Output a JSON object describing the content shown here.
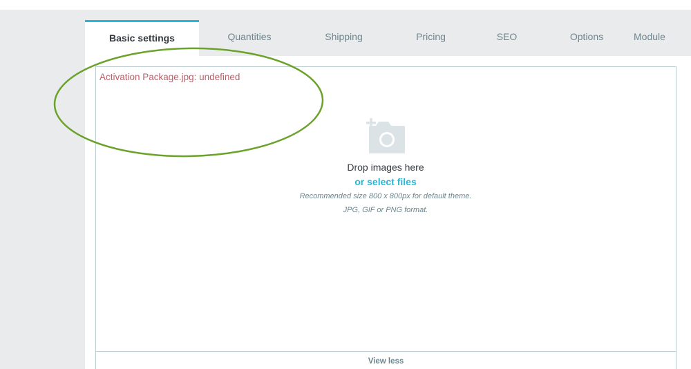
{
  "tabs": [
    {
      "label": "Basic settings",
      "active": true
    },
    {
      "label": "Quantities"
    },
    {
      "label": "Shipping"
    },
    {
      "label": "Pricing"
    },
    {
      "label": "SEO"
    },
    {
      "label": "Options"
    },
    {
      "label": "Module"
    }
  ],
  "upload": {
    "error": "Activation Package.jpg: undefined",
    "drop_text": "Drop images here",
    "select_text": "or select files",
    "hint_size": "Recommended size 800 x 800px for default theme.",
    "hint_format": "JPG, GIF or PNG format.",
    "icon": "camera-add-icon"
  },
  "view_less": "View less",
  "colors": {
    "accent": "#25b9d7",
    "error": "#c05c67",
    "annotation": "#6aa22a",
    "border": "#bbcdd2",
    "icon": "#dbe3e6"
  }
}
